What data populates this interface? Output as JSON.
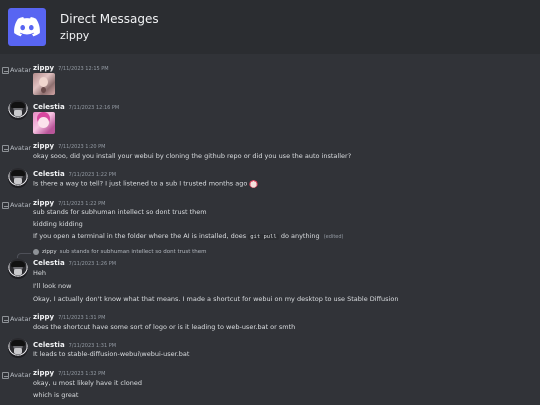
{
  "header": {
    "icon": "discord-logo-icon",
    "accent": "#5865f2",
    "title": "Direct Messages",
    "subtitle": "zippy"
  },
  "avatar_alt": "Avatar",
  "messages": [
    {
      "author": "zippy",
      "time": "7/11/2023 12:15 PM",
      "attachment": "image"
    },
    {
      "author": "Celestia",
      "time": "7/11/2023 12:16 PM",
      "attachment": "image"
    },
    {
      "author": "zippy",
      "time": "7/11/2023 1:20 PM",
      "lines": [
        "okay sooo, did you install your webui by cloning the github repo or did you use the auto installer?"
      ]
    },
    {
      "author": "Celestia",
      "time": "7/11/2023 1:22 PM",
      "lines": [
        "Is there a way to tell? I just listened to a sub I trusted months ago"
      ],
      "emoji": "custom-emoji"
    },
    {
      "author": "zippy",
      "time": "7/11/2023 1:22 PM",
      "lines": [
        "sub stands for subhuman intellect so dont trust them",
        "kidding kidding"
      ],
      "last_line": {
        "before": "If you open a terminal in the folder where the AI is installed, does",
        "code": "git pull",
        "after": "do anything",
        "edited": "(edited)"
      }
    },
    {
      "reply_to": {
        "author": "zippy",
        "text": "sub stands for subhuman intellect so dont trust them"
      },
      "author": "Celestia",
      "time": "7/11/2023 1:26 PM",
      "lines": [
        "Heh",
        "I'll look now",
        "Okay, I actually don't know what that means. I made a shortcut for webui on my desktop to use Stable Diffusion"
      ]
    },
    {
      "author": "zippy",
      "time": "7/11/2023 1:31 PM",
      "lines": [
        "does the shortcut have some sort of logo or is it leading to web-user.bat or smth"
      ]
    },
    {
      "author": "Celestia",
      "time": "7/11/2023 1:31 PM",
      "lines": [
        "It leads to stable-diffusion-webui\\webui-user.bat"
      ]
    },
    {
      "author": "zippy",
      "time": "7/11/2023 1:32 PM",
      "lines": [
        "okay, u most likely have it cloned",
        "which is great"
      ]
    }
  ]
}
